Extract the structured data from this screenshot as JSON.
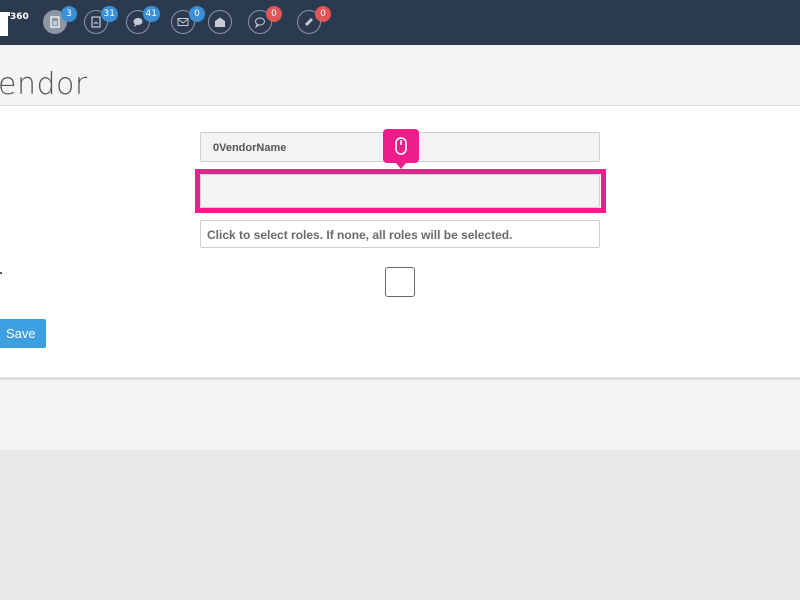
{
  "app": {
    "logo_sup": "360"
  },
  "nav": {
    "icons": [
      {
        "name": "document-icon",
        "badge": "3",
        "badge_color": "#3a8fd6"
      },
      {
        "name": "report-icon",
        "badge": "31",
        "badge_color": "#3a8fd6"
      },
      {
        "name": "chat-icon",
        "badge": "41",
        "badge_color": "#3a8fd6"
      },
      {
        "name": "mail-icon",
        "badge": "0",
        "badge_color": "#3a8fd6"
      },
      {
        "name": "mail-open-icon",
        "badge": "",
        "badge_color": ""
      },
      {
        "name": "comment-icon",
        "badge": "0",
        "badge_color": "#e05656"
      },
      {
        "name": "ticket-icon",
        "badge": "0",
        "badge_color": "#e05656"
      }
    ]
  },
  "page": {
    "title": "endor"
  },
  "form": {
    "vendor_name_value": "0VendorName",
    "middle_field_value": "",
    "roles_placeholder": "Click to select roles. If none, all roles will be selected.",
    "save_label": "Save"
  },
  "colors": {
    "topbar": "#2c3a4f",
    "highlight": "#ee1d8a",
    "save_button": "#3d9ee0"
  },
  "tooltip": {
    "icon": "mouse-icon"
  }
}
